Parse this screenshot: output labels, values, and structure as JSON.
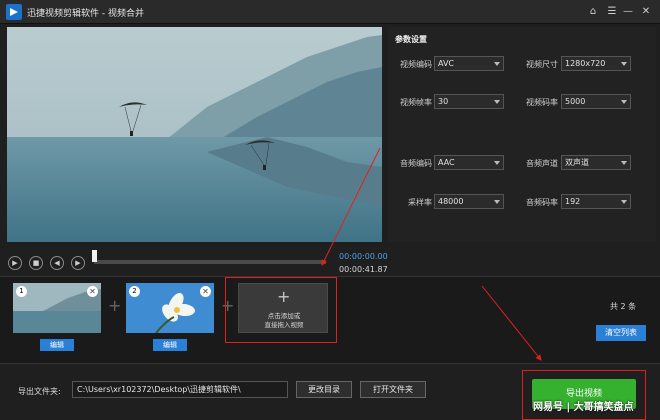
{
  "window": {
    "title": "迅捷视频剪辑软件 - 视频合并",
    "controls": {
      "home_icon": "home-icon",
      "menu_icon": "menu-icon",
      "min_icon": "minimize-icon",
      "close_icon": "close-icon"
    }
  },
  "player": {
    "current_time": "00:00:00.00",
    "total_time": "00:00:41.87",
    "progress": 0,
    "buttons": [
      "play-icon",
      "stop-icon",
      "volume-icon",
      "next-frame-icon"
    ]
  },
  "settings": {
    "title": "参数设置",
    "rows": [
      {
        "left_label": "视频编码",
        "left_value": "AVC",
        "right_label": "视频尺寸",
        "right_value": "1280x720"
      },
      {
        "left_label": "视频帧率",
        "left_value": "30",
        "right_label": "视频码率",
        "right_value": "5000"
      },
      {
        "left_label": "音频编码",
        "left_value": "AAC",
        "right_label": "音频声道",
        "right_value": "双声道"
      },
      {
        "left_label": "采样率",
        "left_value": "48000",
        "right_label": "音频码率",
        "right_value": "192"
      }
    ]
  },
  "clips": [
    {
      "index": "1",
      "edit_label": "编辑"
    },
    {
      "index": "2",
      "edit_label": "编辑"
    }
  ],
  "add_box": {
    "line1": "点击添加或",
    "line2": "直接拖入视频"
  },
  "clip_count": "共 2 条",
  "clear_label": "清空列表",
  "export": {
    "label": "导出文件夹:",
    "path": "C:\\Users\\xr102372\\Desktop\\迅捷剪辑软件\\",
    "change_dir": "更改目录",
    "open_folder": "打开文件夹",
    "export_button": "导出视频"
  },
  "watermark": "网易号 | 大哥搞笑盘点",
  "colors": {
    "accent_blue": "#2a7fd6",
    "export_green": "#35b02f",
    "annotation_red": "#e02020"
  }
}
